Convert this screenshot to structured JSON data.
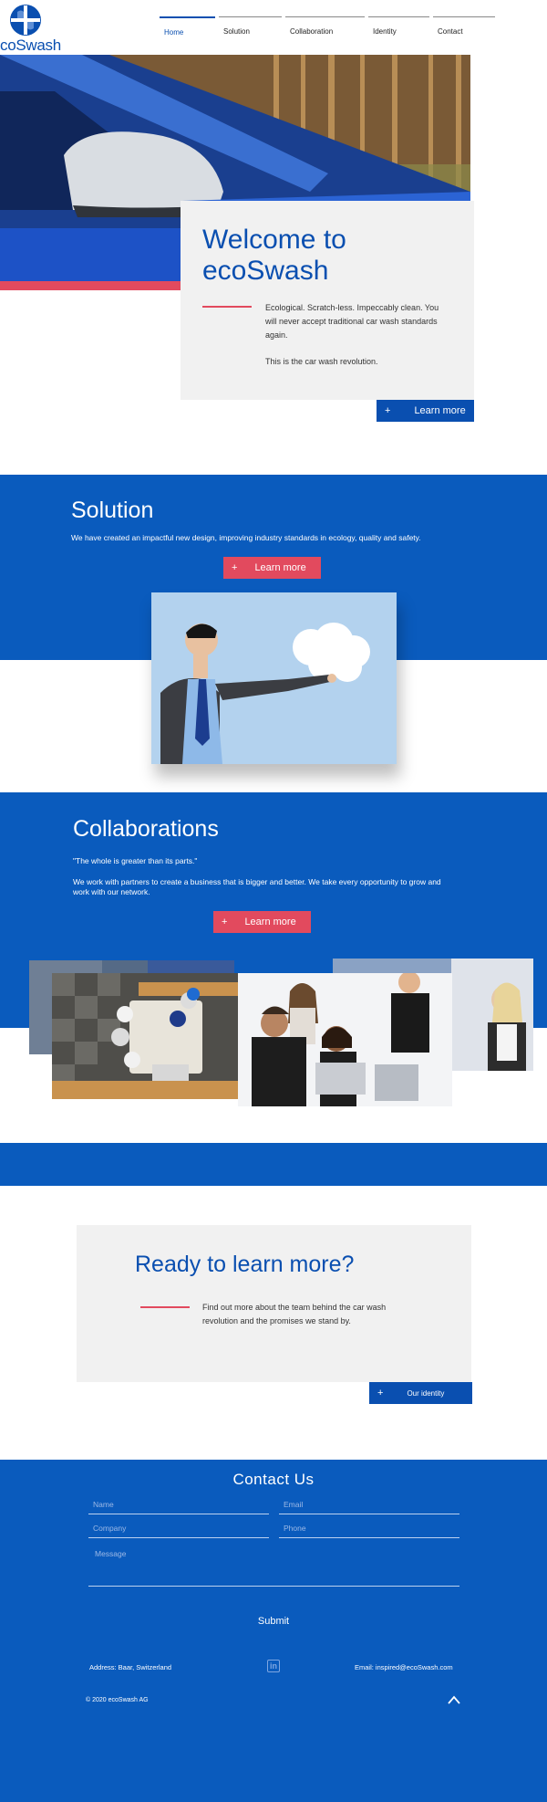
{
  "brand": {
    "logo_text": "coSwash",
    "color": "#0a4fb0"
  },
  "nav": {
    "items": [
      {
        "label": "Home"
      },
      {
        "label": "Solution"
      },
      {
        "label": "Collaboration"
      },
      {
        "label": "Identity"
      },
      {
        "label": "Contact"
      }
    ]
  },
  "hero": {
    "title_line1": "Welcome to",
    "title_line2": "ecoSwash",
    "body_1": "Ecological. Scratch-less. Impeccably clean. You will never accept traditional car wash standards again.",
    "body_2": "This is the car wash revolution.",
    "button_icon": "+",
    "button_label": "Learn more"
  },
  "solution": {
    "title": "Solution",
    "text": "We have created an impactful new design, improving industry standards in ecology, quality and safety.",
    "button_icon": "+",
    "button_label": "Learn more"
  },
  "collaborations": {
    "title": "Collaborations",
    "quote": "\"The whole is greater than its parts.\"",
    "text": "We work with partners to create a business that is bigger and better. We take every opportunity to grow and work with our network.",
    "button_icon": "+",
    "button_label": "Learn more"
  },
  "ready": {
    "title": "Ready to learn more?",
    "text": "Find out more about the team behind the car wash revolution and the promises we stand by.",
    "button_icon": "+",
    "button_label": "Our identity"
  },
  "contact": {
    "title": "Contact Us",
    "name_placeholder": "Name",
    "email_placeholder": "Email",
    "company_placeholder": "Company",
    "phone_placeholder": "Phone",
    "message_placeholder": "Message",
    "submit_label": "Submit"
  },
  "footer": {
    "address": "Address: Baar, Switzerland",
    "linkedin_icon": "in",
    "email": "Email: inspired@ecoSwash.com",
    "copyright": "© 2020 ecoSwash AG",
    "to_top_icon": "chevron-up-icon"
  },
  "colors": {
    "primary_blue": "#0a5bbd",
    "accent_red": "#e24a5e",
    "card_gray": "#f1f1f1"
  }
}
